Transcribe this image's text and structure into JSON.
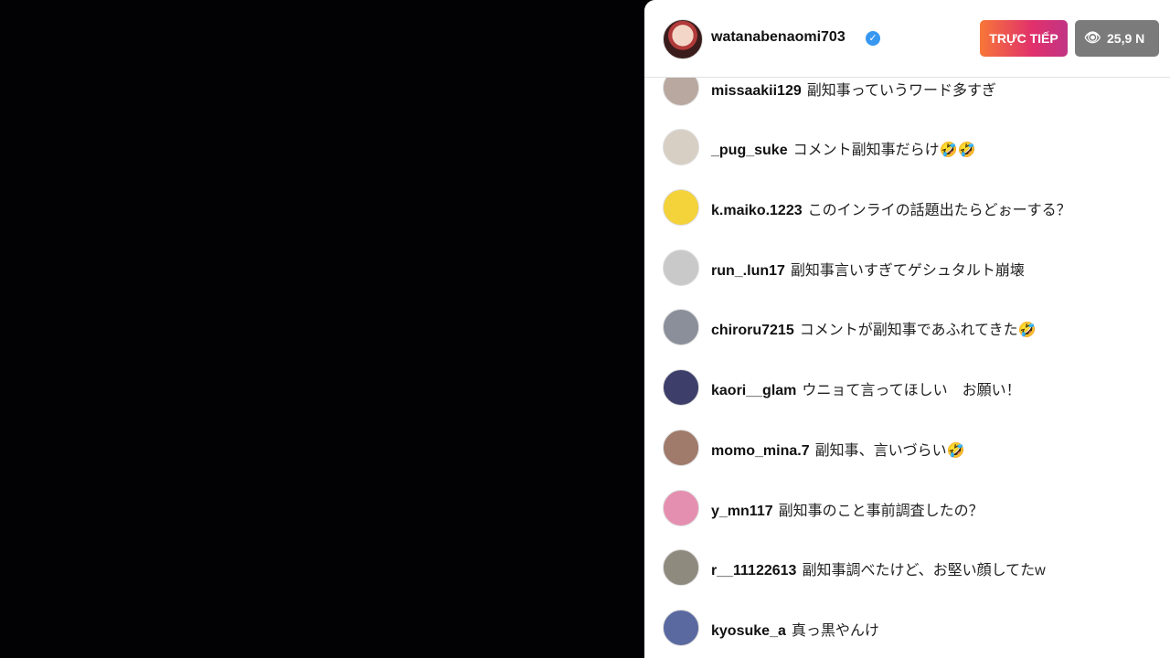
{
  "host": {
    "username": "watanabenaomi703",
    "verified_icon": "verified-badge-icon",
    "live_label": "TRỰC TIẾP",
    "viewers_icon": "eye-icon",
    "viewers": "25,9 N"
  },
  "comments": [
    {
      "user": "missaakii129",
      "text": "副知事っていうワード多すぎ",
      "avatar_color": "#b9a8a0"
    },
    {
      "user": "_pug_suke",
      "text": "コメント副知事だらけ🤣🤣",
      "avatar_color": "#d8cfc4"
    },
    {
      "user": "k.maiko.1223",
      "text": "このインライの話題出たらどぉーする？",
      "avatar_color": "#f4d23a"
    },
    {
      "user": "run_.lun17",
      "text": "副知事言いすぎてゲシュタルト崩壊",
      "avatar_color": "#c9c9c9"
    },
    {
      "user": "chiroru7215",
      "text": "コメントが副知事であふれてきた🤣",
      "avatar_color": "#8a8f9a"
    },
    {
      "user": "kaori__glam",
      "text": "ウニョて言ってほしい　お願い！",
      "avatar_color": "#3d3f6a"
    },
    {
      "user": "momo_mina.7",
      "text": "副知事、言いづらい🤣",
      "avatar_color": "#a07a6a"
    },
    {
      "user": "y_mn117",
      "text": "副知事のこと事前調査したの？",
      "avatar_color": "#e58fb0"
    },
    {
      "user": "r__11122613",
      "text": "副知事調べたけど、お堅い顔してたw",
      "avatar_color": "#8f8a7e"
    },
    {
      "user": "kyosuke_a",
      "text": "真っ黒やんけ",
      "avatar_color": "#5a6aa0"
    }
  ]
}
